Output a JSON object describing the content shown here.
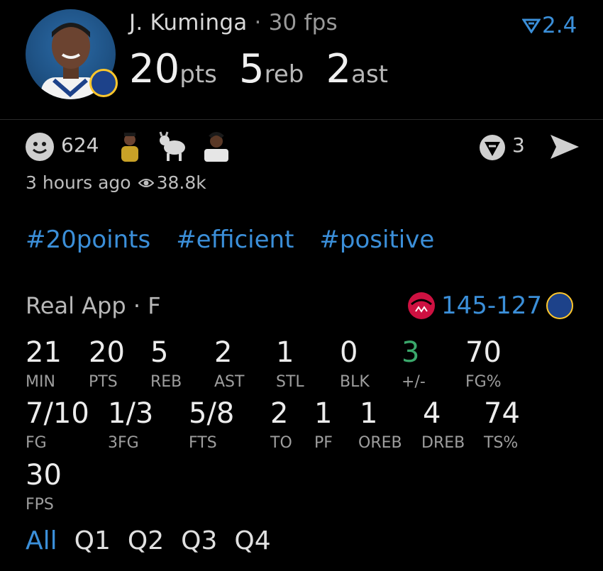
{
  "colors": {
    "accent": "#3b8fd9",
    "positive": "#3aa86b",
    "background": "#000000"
  },
  "player": {
    "name": "J. Kuminga",
    "separator": "·",
    "fps_label": "30 fps",
    "rating": "2.4",
    "pts": "20",
    "pts_unit": "pts",
    "reb": "5",
    "reb_unit": "reb",
    "ast": "2",
    "ast_unit": "ast"
  },
  "reactions": {
    "count": "624",
    "images": [
      "player-reaction-image",
      "goat-emoji",
      "player-reaction-image-2"
    ],
    "comment_count": "3"
  },
  "meta": {
    "time": "3 hours ago",
    "views": "38.8k"
  },
  "tags": [
    "#20points",
    "#efficient",
    "#positive"
  ],
  "game": {
    "source": "Real App",
    "separator": "·",
    "position": "F",
    "score": "145-127"
  },
  "stats_row1": [
    {
      "value": "21",
      "label": "MIN"
    },
    {
      "value": "20",
      "label": "PTS"
    },
    {
      "value": "5",
      "label": "REB"
    },
    {
      "value": "2",
      "label": "AST"
    },
    {
      "value": "1",
      "label": "STL"
    },
    {
      "value": "0",
      "label": "BLK"
    },
    {
      "value": "3",
      "label": "+/-"
    },
    {
      "value": "70",
      "label": "FG%"
    }
  ],
  "stats_row2": [
    {
      "value": "7/10",
      "label": "FG"
    },
    {
      "value": "1/3",
      "label": "3FG"
    },
    {
      "value": "5/8",
      "label": "FTS"
    },
    {
      "value": "2",
      "label": "TO"
    },
    {
      "value": "1",
      "label": "PF"
    },
    {
      "value": "1",
      "label": "OREB"
    },
    {
      "value": "4",
      "label": "DREB"
    },
    {
      "value": "74",
      "label": "TS%"
    }
  ],
  "stats_row3": [
    {
      "value": "30",
      "label": "FPS"
    }
  ],
  "tabs": [
    "All",
    "Q1",
    "Q2",
    "Q3",
    "Q4"
  ]
}
